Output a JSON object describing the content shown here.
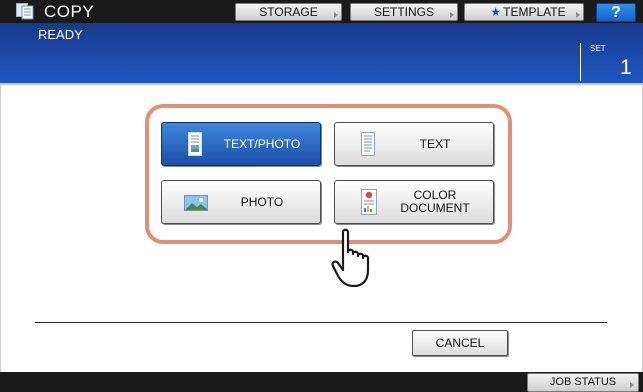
{
  "app": {
    "title": "COPY",
    "icon": "copy-icon"
  },
  "toolbar": {
    "storage_label": "STORAGE",
    "settings_label": "SETTINGS",
    "template_label": "TEMPLATE",
    "help_label": "?"
  },
  "status": {
    "text": "READY",
    "set_label": "SET",
    "set_value": "1"
  },
  "modes": [
    {
      "label": "TEXT/PHOTO",
      "icon": "text-photo-icon",
      "selected": true
    },
    {
      "label": "TEXT",
      "icon": "text-icon",
      "selected": false
    },
    {
      "label": "PHOTO",
      "icon": "photo-icon",
      "selected": false
    },
    {
      "label": "COLOR\nDOCUMENT",
      "icon": "color-document-icon",
      "selected": false
    }
  ],
  "cancel_label": "CANCEL",
  "job_status_label": "JOB STATUS",
  "colors": {
    "accent": "#1f58c6",
    "highlight": "#e48f74",
    "selected": "#2a67c4"
  }
}
